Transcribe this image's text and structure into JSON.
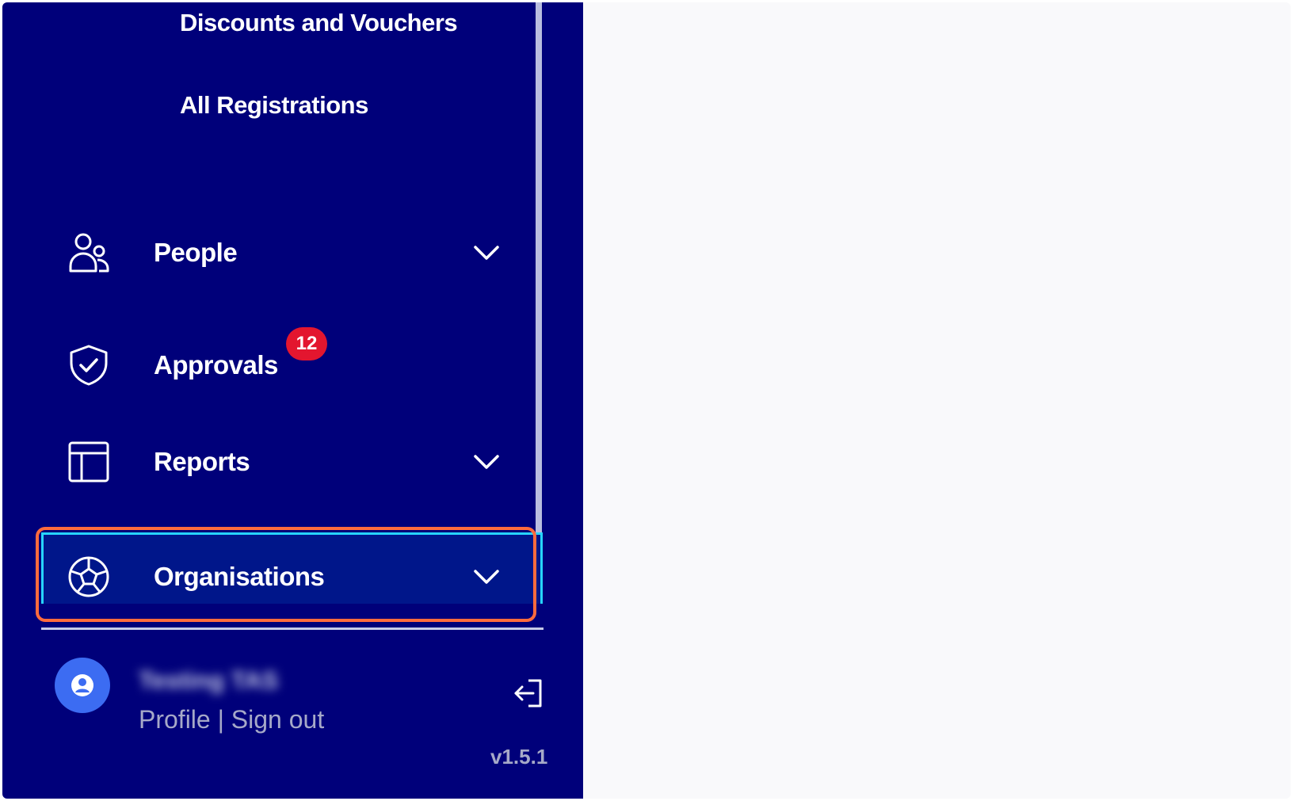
{
  "sidebar": {
    "subitems": {
      "discounts": "Discounts and Vouchers",
      "registrations": "All Registrations"
    },
    "nav": {
      "people": "People",
      "approvals": "Approvals",
      "approvals_badge": "12",
      "reports": "Reports",
      "organisations": "Organisations"
    },
    "user": {
      "name": "Testing TAS",
      "links": "Profile | Sign out"
    },
    "version": "v1.5.1"
  },
  "icons": {
    "people": "people-icon",
    "approvals": "shield-check-icon",
    "reports": "layout-icon",
    "organisations": "soccer-ball-icon",
    "chevron": "chevron-down-icon",
    "avatar": "user-icon",
    "signout": "sign-out-icon"
  },
  "colors": {
    "sidebar_bg": "#00007a",
    "active_bg": "#00168a",
    "active_border": "#27d4ff",
    "highlight": "#ff6b3d",
    "badge": "#e3162f",
    "avatar": "#3c6cf2",
    "content_bg": "#f9f9fb"
  }
}
